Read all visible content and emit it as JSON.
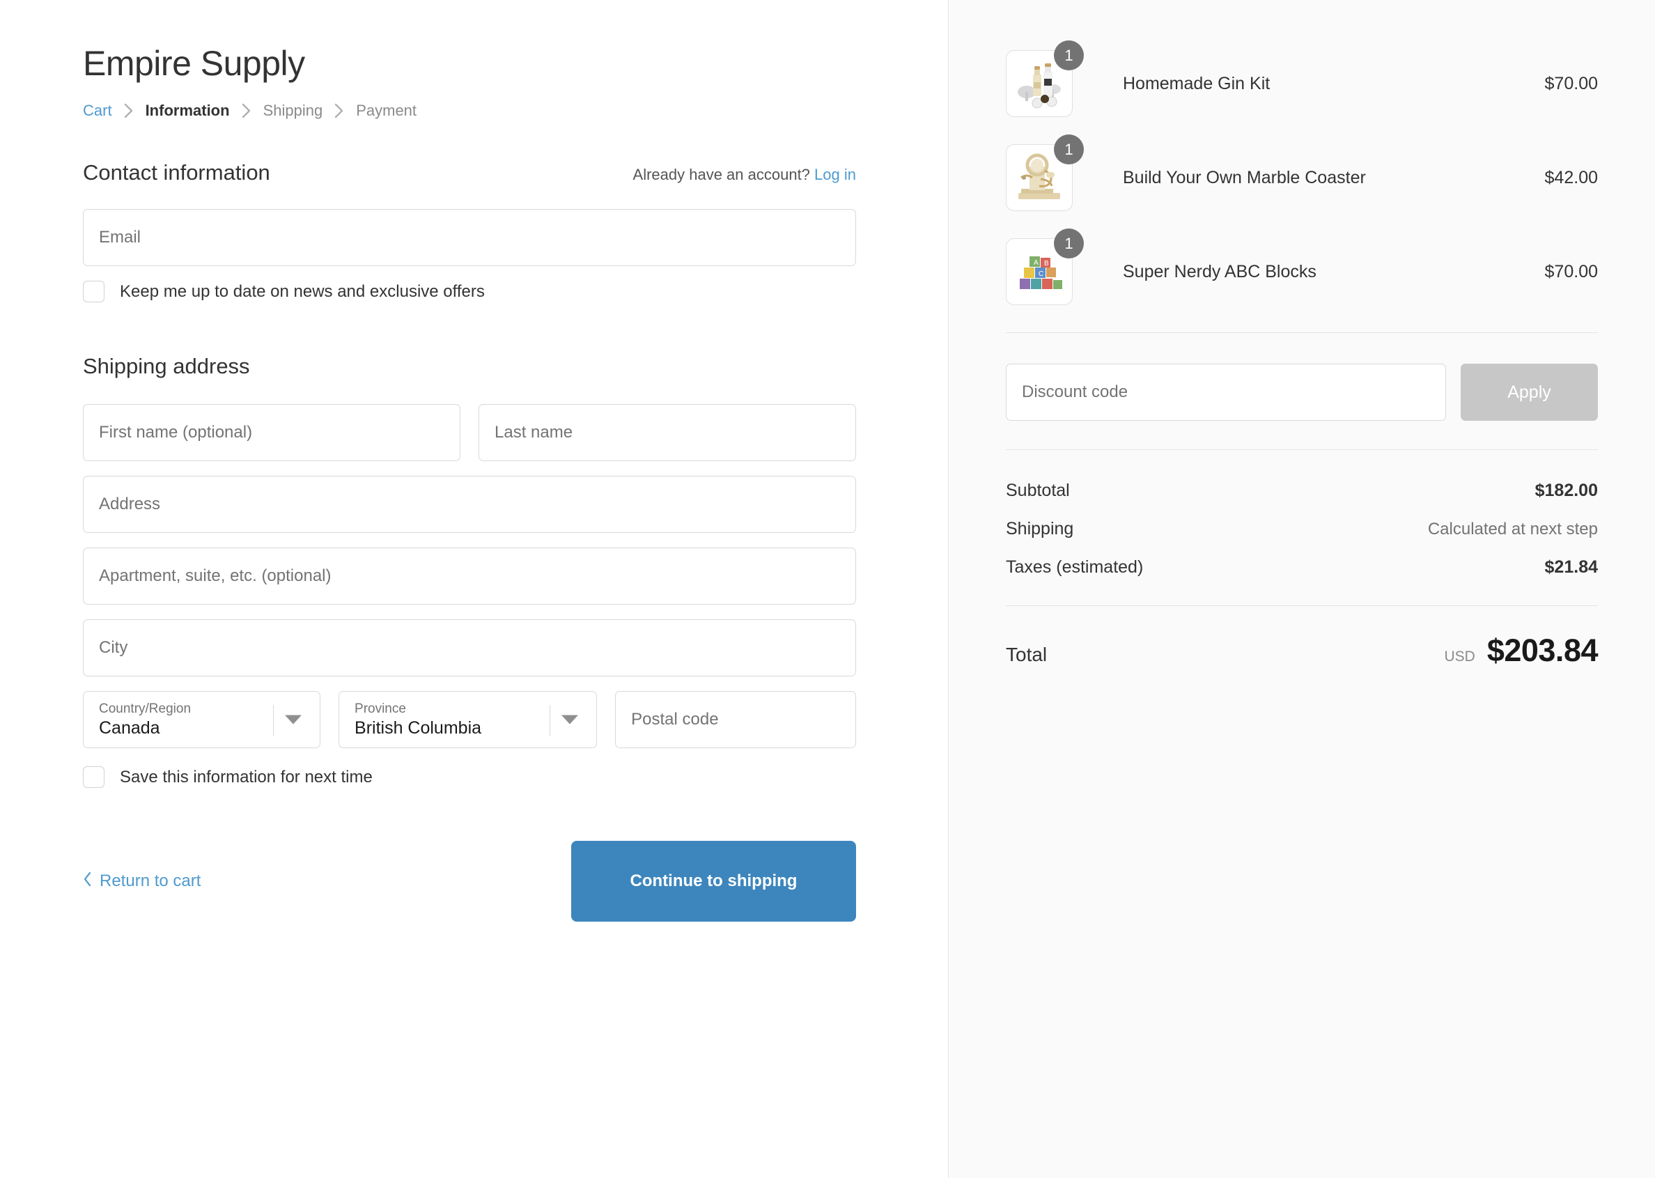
{
  "shop": {
    "name": "Empire Supply"
  },
  "breadcrumb": {
    "items": [
      {
        "label": "Cart",
        "state": "link"
      },
      {
        "label": "Information",
        "state": "current"
      },
      {
        "label": "Shipping",
        "state": "future"
      },
      {
        "label": "Payment",
        "state": "future"
      }
    ]
  },
  "contact": {
    "title": "Contact information",
    "account_prompt": "Already have an account?",
    "login_label": "Log in",
    "email_placeholder": "Email",
    "email_value": "",
    "newsletter_label": "Keep me up to date on news and exclusive offers",
    "newsletter_checked": false
  },
  "shipping": {
    "title": "Shipping address",
    "first_name_placeholder": "First name (optional)",
    "first_name_value": "",
    "last_name_placeholder": "Last name",
    "last_name_value": "",
    "address_placeholder": "Address",
    "address_value": "",
    "apartment_placeholder": "Apartment, suite, etc. (optional)",
    "apartment_value": "",
    "city_placeholder": "City",
    "city_value": "",
    "country_label": "Country/Region",
    "country_value": "Canada",
    "province_label": "Province",
    "province_value": "British Columbia",
    "postal_placeholder": "Postal code",
    "postal_value": "",
    "save_info_label": "Save this information for next time",
    "save_info_checked": false
  },
  "actions": {
    "return_label": "Return to cart",
    "continue_label": "Continue to shipping"
  },
  "summary": {
    "items": [
      {
        "name": "Homemade Gin Kit",
        "price": "$70.00",
        "qty": "1"
      },
      {
        "name": "Build Your Own Marble Coaster",
        "price": "$42.00",
        "qty": "1"
      },
      {
        "name": "Super Nerdy ABC Blocks",
        "price": "$70.00",
        "qty": "1"
      }
    ],
    "discount_placeholder": "Discount code",
    "discount_value": "",
    "apply_label": "Apply",
    "totals": [
      {
        "label": "Subtotal",
        "value": "$182.00",
        "muted": false
      },
      {
        "label": "Shipping",
        "value": "Calculated at next step",
        "muted": true
      },
      {
        "label": "Taxes (estimated)",
        "value": "$21.84",
        "muted": false
      }
    ],
    "total_label": "Total",
    "total_currency": "USD",
    "total_amount": "$203.84"
  },
  "colors": {
    "accent": "#3d86bd",
    "link": "#4f9ace",
    "sidebar_bg": "#fafafa",
    "border": "#d9d9d9",
    "badge": "#737373",
    "apply_disabled": "#c7c7c7"
  }
}
